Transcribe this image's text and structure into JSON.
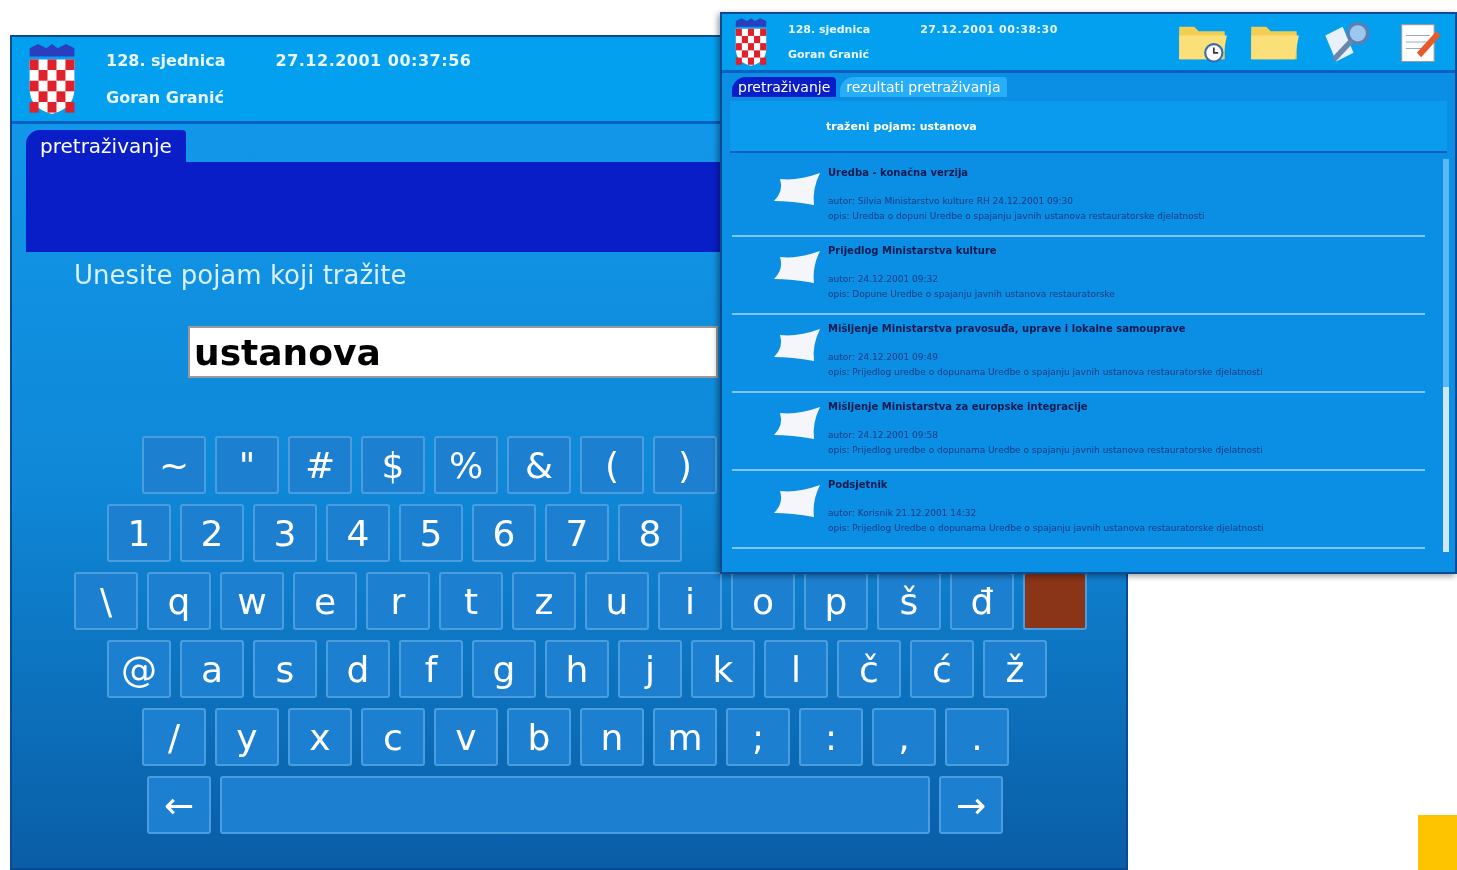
{
  "search_window": {
    "header": {
      "session": "128. sjednica",
      "datetime": "27.12.2001 00:37:56",
      "user": "Goran Granić"
    },
    "tabs": [
      {
        "label": "pretraživanje",
        "selected": true
      }
    ],
    "prompt": "Unesite pojam koji tražite",
    "search_field": {
      "value": "ustanova"
    },
    "keyboard": [
      [
        {
          "kind": "char",
          "label": "~"
        },
        {
          "kind": "char",
          "label": "\""
        },
        {
          "kind": "char",
          "label": "#"
        },
        {
          "kind": "char",
          "label": "$"
        },
        {
          "kind": "char",
          "label": "%"
        },
        {
          "kind": "char",
          "label": "&"
        },
        {
          "kind": "char",
          "label": "("
        },
        {
          "kind": "char",
          "label": ")"
        }
      ],
      [
        {
          "kind": "char",
          "label": "1"
        },
        {
          "kind": "char",
          "label": "2"
        },
        {
          "kind": "char",
          "label": "3"
        },
        {
          "kind": "char",
          "label": "4"
        },
        {
          "kind": "char",
          "label": "5"
        },
        {
          "kind": "char",
          "label": "6"
        },
        {
          "kind": "char",
          "label": "7"
        },
        {
          "kind": "char",
          "label": "8"
        }
      ],
      [
        {
          "kind": "char",
          "label": "\\"
        },
        {
          "kind": "char",
          "label": "q"
        },
        {
          "kind": "char",
          "label": "w"
        },
        {
          "kind": "char",
          "label": "e"
        },
        {
          "kind": "char",
          "label": "r"
        },
        {
          "kind": "char",
          "label": "t"
        },
        {
          "kind": "char",
          "label": "z"
        },
        {
          "kind": "char",
          "label": "u"
        },
        {
          "kind": "char",
          "label": "i"
        },
        {
          "kind": "char",
          "label": "o"
        },
        {
          "kind": "char",
          "label": "p"
        },
        {
          "kind": "char",
          "label": "š"
        },
        {
          "kind": "char",
          "label": "đ"
        },
        {
          "kind": "swatch",
          "color": "#8a3418"
        }
      ],
      [
        {
          "kind": "char",
          "label": "@"
        },
        {
          "kind": "char",
          "label": "a"
        },
        {
          "kind": "char",
          "label": "s"
        },
        {
          "kind": "char",
          "label": "d"
        },
        {
          "kind": "char",
          "label": "f"
        },
        {
          "kind": "char",
          "label": "g"
        },
        {
          "kind": "char",
          "label": "h"
        },
        {
          "kind": "char",
          "label": "j"
        },
        {
          "kind": "char",
          "label": "k"
        },
        {
          "kind": "char",
          "label": "l"
        },
        {
          "kind": "char",
          "label": "č"
        },
        {
          "kind": "char",
          "label": "ć"
        },
        {
          "kind": "char",
          "label": "ž"
        }
      ],
      [
        {
          "kind": "char",
          "label": "/"
        },
        {
          "kind": "char",
          "label": "y"
        },
        {
          "kind": "char",
          "label": "x"
        },
        {
          "kind": "char",
          "label": "c"
        },
        {
          "kind": "char",
          "label": "v"
        },
        {
          "kind": "char",
          "label": "b"
        },
        {
          "kind": "char",
          "label": "n"
        },
        {
          "kind": "char",
          "label": "m"
        },
        {
          "kind": "char",
          "label": ";"
        },
        {
          "kind": "char",
          "label": ":"
        },
        {
          "kind": "char",
          "label": ","
        },
        {
          "kind": "char",
          "label": "."
        }
      ],
      [
        {
          "kind": "char",
          "label": "←"
        },
        {
          "kind": "space"
        },
        {
          "kind": "char",
          "label": "→"
        }
      ]
    ]
  },
  "results_window": {
    "header": {
      "session": "128. sjednica",
      "datetime": "27.12.2001 00:38:30",
      "user": "Goran Granić"
    },
    "tabs": [
      {
        "label": "pretraživanje",
        "selected": true
      },
      {
        "label": "rezultati pretraživanja",
        "selected": false
      }
    ],
    "query": "traženi pojam: ustanova",
    "results": [
      {
        "title": "Uredba - konačna verzija",
        "author": "autor: Silvia Ministarstvo kulture RH  24.12.2001  09:30",
        "description": "opis: Uredba o dopuni Uredbe o spajanju javnih ustanova restauratorske djelatnosti"
      },
      {
        "title": "Prijedlog Ministarstva kulture",
        "author": "autor:   24.12.2001  09:32",
        "description": "opis: Dopune Uredbe o spajanju javnih ustanova restauratorske"
      },
      {
        "title": "Mišljenje Ministarstva pravosuđa, uprave i lokalne samouprave",
        "author": "autor:   24.12.2001  09:49",
        "description": "opis: Prijedlog uredbe o dopunama Uredbe o spajanju javnih ustanova restauratorske djelatnosti"
      },
      {
        "title": "Mišljenje Ministarstva za europske integracije",
        "author": "autor:   24.12.2001  09:58",
        "description": "opis: Prijedlog uredbe o dopunama Uredbe o spajanju javnih ustanova restauratorske djelatnosti"
      },
      {
        "title": "Podsjetnik",
        "author": "autor: Korisnik  21.12.2001  14:32",
        "description": "opis: Prijedlog Uredbe o dopunama Uredbe o spajanju javnih ustanova restauratorske djelatnosti"
      }
    ]
  }
}
